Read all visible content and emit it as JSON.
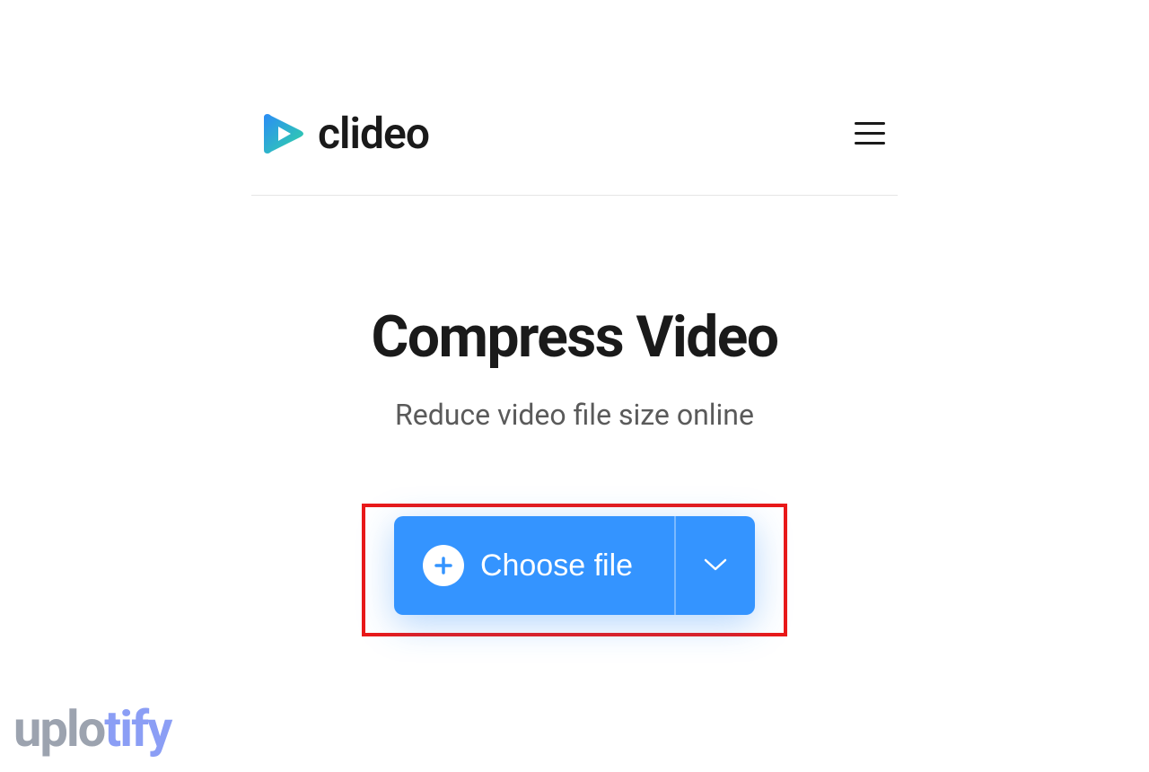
{
  "header": {
    "brand_name": "clideo"
  },
  "main": {
    "title": "Compress Video",
    "subtitle": "Reduce video file size online",
    "choose_file_label": "Choose file"
  },
  "watermark": {
    "part1": "uplo",
    "part2": "tify"
  },
  "colors": {
    "primary_button": "#3494ff",
    "highlight_border": "#e91919"
  }
}
